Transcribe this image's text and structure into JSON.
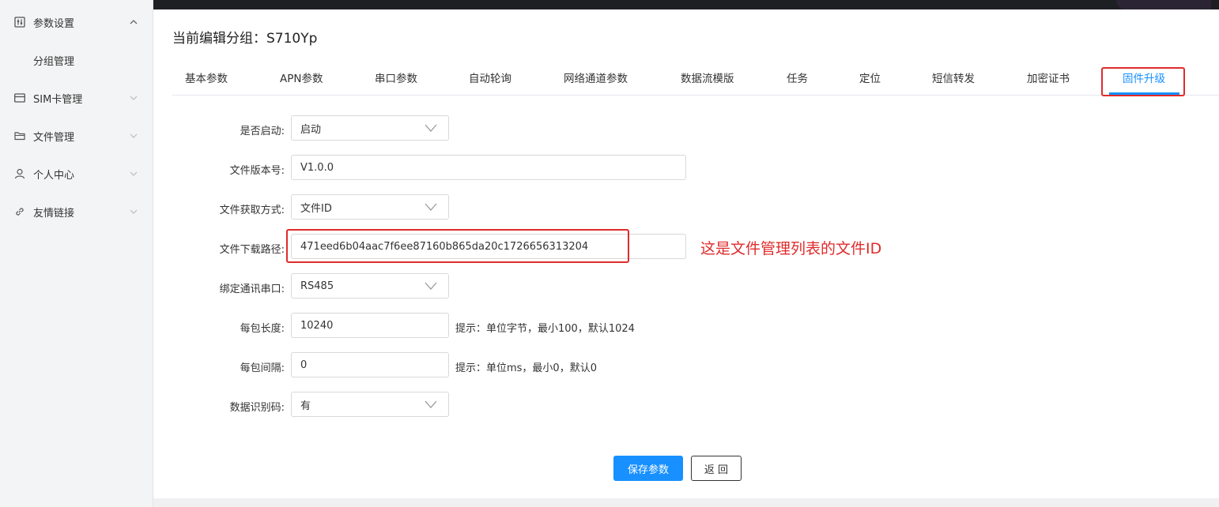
{
  "sidebar": {
    "items": [
      {
        "label": "参数设置",
        "icon": "sliders-icon",
        "arrow": "up"
      },
      {
        "label": "分组管理",
        "sub": true
      },
      {
        "label": "SIM卡管理",
        "icon": "card-icon",
        "arrow": "down"
      },
      {
        "label": "文件管理",
        "icon": "folder-icon",
        "arrow": "down"
      },
      {
        "label": "个人中心",
        "icon": "user-icon",
        "arrow": "down"
      },
      {
        "label": "友情链接",
        "icon": "link-icon",
        "arrow": "down"
      }
    ]
  },
  "header": {
    "title": "当前编辑分组：S710Yp"
  },
  "tabs": [
    {
      "label": "基本参数"
    },
    {
      "label": "APN参数"
    },
    {
      "label": "串口参数"
    },
    {
      "label": "自动轮询"
    },
    {
      "label": "网络通道参数"
    },
    {
      "label": "数据流模版"
    },
    {
      "label": "任务"
    },
    {
      "label": "定位"
    },
    {
      "label": "短信转发"
    },
    {
      "label": "加密证书"
    },
    {
      "label": "固件升级",
      "active": true
    }
  ],
  "form": {
    "enable": {
      "label": "是否启动:",
      "value": "启动"
    },
    "version": {
      "label": "文件版本号:",
      "value": "V1.0.0"
    },
    "fetch_method": {
      "label": "文件获取方式:",
      "value": "文件ID"
    },
    "download_path": {
      "label": "文件下载路径:",
      "value": "471eed6b04aac7f6ee87160b865da20c1726656313204"
    },
    "serial_port": {
      "label": "绑定通讯串口:",
      "value": "RS485"
    },
    "packet_length": {
      "label": "每包长度:",
      "value": "10240",
      "hint": "提示：单位字节，最小100，默认1024"
    },
    "packet_interval": {
      "label": "每包间隔:",
      "value": "0",
      "hint": "提示：单位ms，最小0，默认0"
    },
    "data_id_code": {
      "label": "数据识别码:",
      "value": "有"
    }
  },
  "annotation": {
    "text": "这是文件管理列表的文件ID"
  },
  "buttons": {
    "save": "保存参数",
    "back": "返 回"
  },
  "colors": {
    "accent": "#1890ff",
    "annotation": "#e02b2b"
  }
}
